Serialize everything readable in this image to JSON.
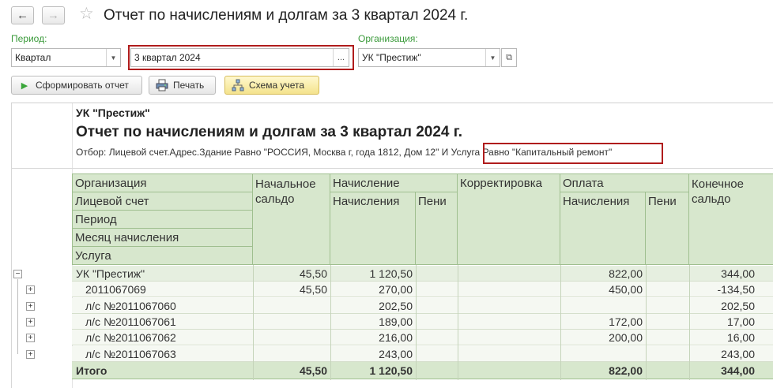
{
  "window": {
    "title": "Отчет по начислениям и долгам за 3 квартал 2024 г."
  },
  "filters": {
    "period_label": "Период:",
    "period_type": "Квартал",
    "period_value": "3 квартал 2024",
    "period_open": "...",
    "org_label": "Организация:",
    "org_value": "УК \"Престиж\""
  },
  "toolbar": {
    "generate_label": "Сформировать отчет",
    "print_label": "Печать",
    "scheme_label": "Схема учета"
  },
  "report": {
    "org": "УК \"Престиж\"",
    "title": "Отчет по начислениям и долгам за 3 квартал 2024 г.",
    "filter_prefix": "Отбор: Лицевой счет.Адрес.Здание Равно \"РОССИЯ, Москва г, года 1812, Дом 12\" И ",
    "filter_highlight": "Услуга Равно \"Капитальный ремонт\""
  },
  "table": {
    "group_headers": [
      "Организация",
      "Лицевой счет",
      "Период",
      "Месяц начисления",
      "Услуга"
    ],
    "col_opening": "Начальное сальдо",
    "col_opening_l1": "Начальное",
    "col_opening_l2": "сальдо",
    "col_charge": "Начисление",
    "col_charge_sub": "Начисления",
    "col_charge_pen": "Пени",
    "col_adjust": "Корректировка",
    "col_payment": "Оплата",
    "col_payment_sub": "Начисления",
    "col_payment_pen": "Пени",
    "col_closing_l1": "Конечное",
    "col_closing_l2": "сальдо",
    "rows": [
      {
        "name": "УК \"Престиж\"",
        "opening": "45,50",
        "charge": "1 120,50",
        "charge_pen": "",
        "adjust": "",
        "pay": "822,00",
        "pay_pen": "",
        "closing": "344,00",
        "level": 0,
        "toggle": "−"
      },
      {
        "name": "2011067069",
        "opening": "45,50",
        "charge": "270,00",
        "charge_pen": "",
        "adjust": "",
        "pay": "450,00",
        "pay_pen": "",
        "closing": "-134,50",
        "level": 1,
        "toggle": "+"
      },
      {
        "name": "л/с №2011067060",
        "opening": "",
        "charge": "202,50",
        "charge_pen": "",
        "adjust": "",
        "pay": "",
        "pay_pen": "",
        "closing": "202,50",
        "level": 1,
        "toggle": "+"
      },
      {
        "name": "л/с №2011067061",
        "opening": "",
        "charge": "189,00",
        "charge_pen": "",
        "adjust": "",
        "pay": "172,00",
        "pay_pen": "",
        "closing": "17,00",
        "level": 1,
        "toggle": "+"
      },
      {
        "name": "л/с №2011067062",
        "opening": "",
        "charge": "216,00",
        "charge_pen": "",
        "adjust": "",
        "pay": "200,00",
        "pay_pen": "",
        "closing": "16,00",
        "level": 1,
        "toggle": "+"
      },
      {
        "name": "л/с №2011067063",
        "opening": "",
        "charge": "243,00",
        "charge_pen": "",
        "adjust": "",
        "pay": "",
        "pay_pen": "",
        "closing": "243,00",
        "level": 1,
        "toggle": "+"
      }
    ],
    "total": {
      "name": "Итого",
      "opening": "45,50",
      "charge": "1 120,50",
      "pay": "822,00",
      "closing": "344,00"
    }
  },
  "colors": {
    "accent_green": "#3a9a3a",
    "header_bg": "#d7e7cd",
    "highlight_red": "#b01c1c"
  },
  "icons": {
    "back": "arrow-left-icon",
    "forward": "arrow-right-icon",
    "favorite": "star-icon",
    "generate": "play-icon",
    "print": "printer-icon",
    "scheme": "scheme-icon"
  }
}
